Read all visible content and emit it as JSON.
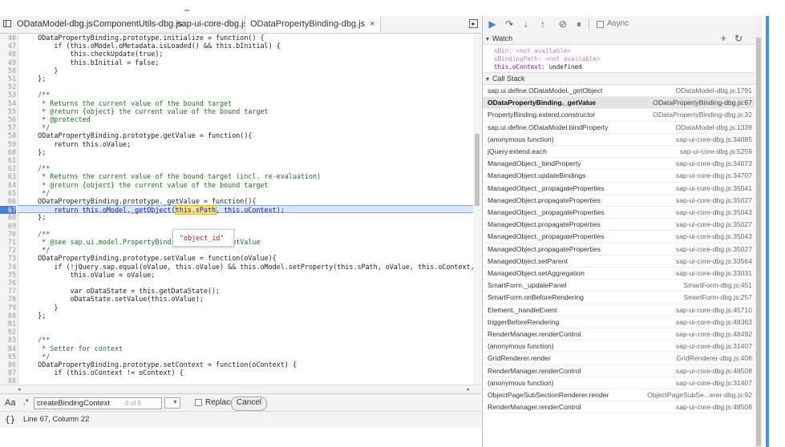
{
  "tabs": [
    {
      "label": "ODataModel-dbg.js"
    },
    {
      "label": "ComponentUtils-dbg.js"
    },
    {
      "label": "sap-ui-core-dbg.js"
    },
    {
      "label": "ODataPropertyBinding-dbg.js",
      "active": true
    }
  ],
  "tab_close": "×",
  "code": {
    "lines": [
      {
        "n": "46",
        "t": "    ODataPropertyBinding.prototype.initialize = function() {"
      },
      {
        "n": "47",
        "t": "        if (this.oModel.oMetadata.isLoaded() && this.bInitial) {"
      },
      {
        "n": "48",
        "t": "            this.checkUpdate(true);"
      },
      {
        "n": "49",
        "t": "            this.bInitial = false;"
      },
      {
        "n": "50",
        "t": "        }"
      },
      {
        "n": "51",
        "t": "    };"
      },
      {
        "n": "52",
        "t": ""
      },
      {
        "n": "53",
        "t": "    /**",
        "c": true
      },
      {
        "n": "54",
        "t": "     * Returns the current value of the bound target",
        "c": true
      },
      {
        "n": "55",
        "t": "     * @return {object} the current value of the bound target",
        "c": true
      },
      {
        "n": "56",
        "t": "     * @protected",
        "c": true
      },
      {
        "n": "57",
        "t": "     */",
        "c": true
      },
      {
        "n": "58",
        "t": "    ODataPropertyBinding.prototype.getValue = function(){"
      },
      {
        "n": "59",
        "t": "        return this.oValue;"
      },
      {
        "n": "60",
        "t": "    };"
      },
      {
        "n": "61",
        "t": ""
      },
      {
        "n": "62",
        "t": "    /**",
        "c": true
      },
      {
        "n": "63",
        "t": "     * Returns the current value of the bound target (incl. re-evaluation)",
        "c": true
      },
      {
        "n": "64",
        "t": "     * @return {object} the current value of the bound target",
        "c": true
      },
      {
        "n": "65",
        "t": "     */",
        "c": true
      },
      {
        "n": "66",
        "t": "    ODataPropertyBinding.prototype._getValue = function(){"
      },
      {
        "n": "67",
        "t": "",
        "hl": true
      },
      {
        "n": "68",
        "t": "    };"
      },
      {
        "n": "69",
        "t": ""
      },
      {
        "n": "70",
        "t": "    /**",
        "c": true
      },
      {
        "n": "71",
        "t": "     * @see sap.ui.model.PropertyBinding.prototype.setValue",
        "c": true
      },
      {
        "n": "72",
        "t": "     */",
        "c": true
      },
      {
        "n": "73",
        "t": "    ODataPropertyBinding.prototype.setValue = function(oValue){"
      },
      {
        "n": "74",
        "t": "        if (!jQuery.sap.equal(oValue, this.oValue) && this.oModel.setProperty(this.sPath, oValue, this.oContext, true)) {"
      },
      {
        "n": "75",
        "t": "            this.oValue = oValue;"
      },
      {
        "n": "76",
        "t": ""
      },
      {
        "n": "77",
        "t": "            var oDataState = this.getDataState();"
      },
      {
        "n": "78",
        "t": "            oDataState.setValue(this.oValue);"
      },
      {
        "n": "79",
        "t": "        }"
      },
      {
        "n": "80",
        "t": "    };"
      },
      {
        "n": "81",
        "t": ""
      },
      {
        "n": "82",
        "t": ""
      },
      {
        "n": "83",
        "t": "    /**",
        "c": true
      },
      {
        "n": "84",
        "t": "     * Setter for context",
        "c": true
      },
      {
        "n": "85",
        "t": "     */",
        "c": true
      },
      {
        "n": "86",
        "t": "    ODataPropertyBinding.prototype.setContext = function(oContext) {"
      },
      {
        "n": "87",
        "t": "        if (this.oContext != oContext) {"
      },
      {
        "n": "88",
        "t": ""
      }
    ],
    "hl_before": "        return this.oModel.",
    "hl_call": "_getObject(",
    "hl_selected": "this.sPath",
    "hl_after": ", this.oContext);",
    "popover_value": "\"object_id\""
  },
  "find": {
    "aa": "Aa",
    "regex": ".*",
    "value": "createBindingContext",
    "count": "0 of 0",
    "up_icon": "▲",
    "down_icon": "▼",
    "replace_label": "Replace",
    "cancel_label": "Cancel"
  },
  "status": {
    "braces": "{}",
    "position": "Line 67, Column 22"
  },
  "debugger": {
    "async_label": "Async",
    "watch_title": "Watch",
    "watch_add": "+",
    "watch_refresh": "↻",
    "watch": [
      {
        "name": "sBin:",
        "value": " <not available>",
        "dim": true
      },
      {
        "name": "sBindingPath:",
        "value": " <not available>",
        "dim": true
      },
      {
        "name": "this.oContext:",
        "value": " undefined",
        "dim": false
      }
    ],
    "callstack_title": "Call Stack",
    "frames": [
      {
        "fn": "sap.ui.define.ODataModel._getObject",
        "loc": "ODataModel-dbg.js:1791"
      },
      {
        "fn": "ODataPropertyBinding._getValue",
        "loc": "ODataPropertyBinding-dbg.js:67",
        "active": true
      },
      {
        "fn": "PropertyBinding.extend.constructor",
        "loc": "ODataPropertyBinding-dbg.js:32"
      },
      {
        "fn": "sap.ui.define.ODataModel.bindProperty",
        "loc": "ODataModel-dbg.js:1339"
      },
      {
        "fn": "(anonymous function)",
        "loc": "sap-ui-core-dbg.js:34085"
      },
      {
        "fn": "jQuery.extend.each",
        "loc": "sap-ui-core-dbg.js:5259"
      },
      {
        "fn": "ManagedObject._bindProperty",
        "loc": "sap-ui-core-dbg.js:34073"
      },
      {
        "fn": "ManagedObject.updateBindings",
        "loc": "sap-ui-core-dbg.js:34707"
      },
      {
        "fn": "ManagedObject._propagateProperties",
        "loc": "sap-ui-core-dbg.js:35041"
      },
      {
        "fn": "ManagedObject.propagateProperties",
        "loc": "sap-ui-core-dbg.js:35027"
      },
      {
        "fn": "ManagedObject._propagateProperties",
        "loc": "sap-ui-core-dbg.js:35043"
      },
      {
        "fn": "ManagedObject.propagateProperties",
        "loc": "sap-ui-core-dbg.js:35027"
      },
      {
        "fn": "ManagedObject._propagateProperties",
        "loc": "sap-ui-core-dbg.js:35043"
      },
      {
        "fn": "ManagedObject.propagateProperties",
        "loc": "sap-ui-core-dbg.js:35027"
      },
      {
        "fn": "ManagedObject.setParent",
        "loc": "sap-ui-core-dbg.js:33564"
      },
      {
        "fn": "ManagedObject.setAggregation",
        "loc": "sap-ui-core-dbg.js:33031"
      },
      {
        "fn": "SmartForm._updatePanel",
        "loc": "SmartForm-dbg.js:451"
      },
      {
        "fn": "SmartForm.onBeforeRendering",
        "loc": "SmartForm-dbg.js:257"
      },
      {
        "fn": "Element._handleEvent",
        "loc": "sap-ui-core-dbg.js:45710"
      },
      {
        "fn": "triggerBeforeRendering",
        "loc": "sap-ui-core-dbg.js:48363"
      },
      {
        "fn": "RenderManager.renderControl",
        "loc": "sap-ui-core-dbg.js:48492"
      },
      {
        "fn": "(anonymous function)",
        "loc": "sap-ui-core-dbg.js:31407"
      },
      {
        "fn": "GridRenderer.render",
        "loc": "GridRenderer-dbg.js:406"
      },
      {
        "fn": "RenderManager.renderControl",
        "loc": "sap-ui-core-dbg.js:48508"
      },
      {
        "fn": "(anonymous function)",
        "loc": "sap-ui-core-dbg.js:31407"
      },
      {
        "fn": "ObjectPageSubSectionRenderer.render",
        "loc": "ObjectPageSubSe...erer-dbg.js:92"
      },
      {
        "fn": "RenderManager.renderControl",
        "loc": "sap-ui-core-dbg.js:48508"
      }
    ]
  },
  "colors": {
    "accent": "#4a7ecf",
    "comment": "#236e25",
    "string": "#c41a16",
    "selection": "#f7e28a"
  }
}
